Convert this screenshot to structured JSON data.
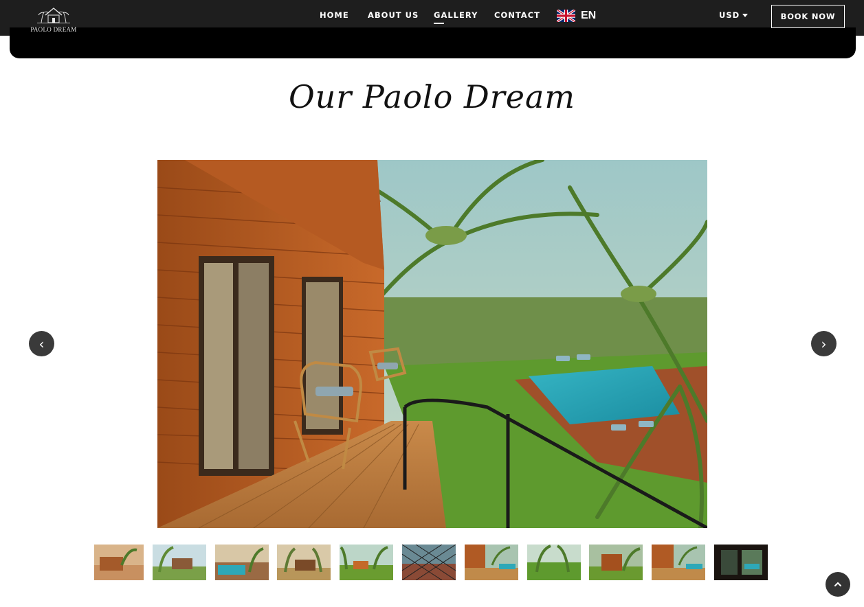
{
  "header": {
    "logo_text": "PAOLO DREAM",
    "nav": [
      {
        "label": "HOME",
        "active": false
      },
      {
        "label": "ABOUT US",
        "active": false
      },
      {
        "label": "GALLERY",
        "active": true
      },
      {
        "label": "CONTACT",
        "active": false
      }
    ],
    "language": {
      "label": "EN",
      "flag": "uk-flag-icon"
    },
    "currency": {
      "label": "USD"
    },
    "book_button": "BOOK NOW"
  },
  "gallery": {
    "title": "Our Paolo Dream",
    "prev_arrow": "‹",
    "next_arrow": "›",
    "thumbnail_count": 11,
    "selected_thumbnail": 7
  },
  "colors": {
    "header_bg": "#1e1e1e",
    "accent": "#ffffff",
    "arrow_bg": "#3a3a3a"
  }
}
